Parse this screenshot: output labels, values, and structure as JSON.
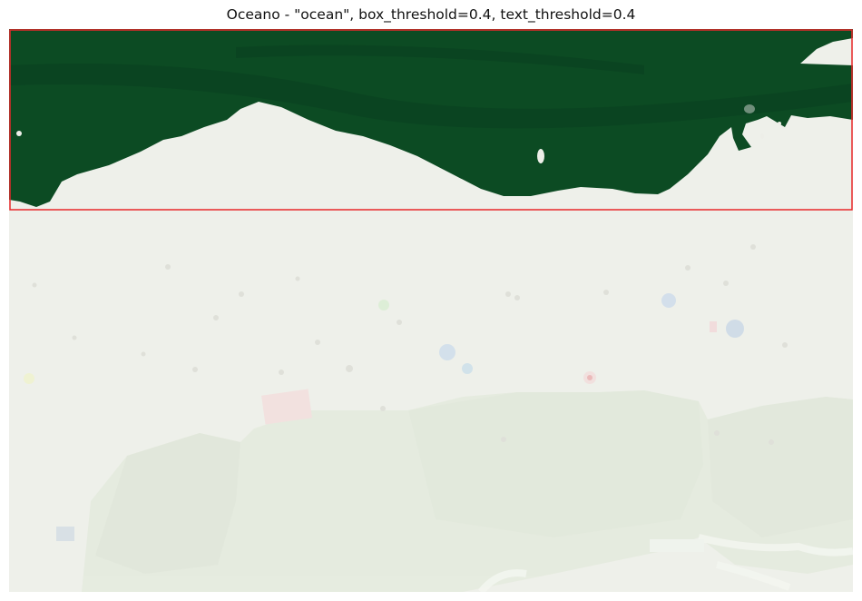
{
  "figure": {
    "title": "Oceano - \"ocean\", box_threshold=0.4, text_threshold=0.4"
  },
  "detection": {
    "label": "ocean",
    "box_threshold": 0.4,
    "text_threshold": 0.4,
    "box_color": "#e8282b"
  },
  "colors": {
    "mask": "#0c4b23",
    "beach_sand": "#edeee8",
    "beach_haze": "#eef1e9",
    "vegetation": "#dfe6d8",
    "path": "#f2f4ef"
  },
  "icons": {
    "umbrellas": "umbrella-icon",
    "people": "person-icon"
  }
}
